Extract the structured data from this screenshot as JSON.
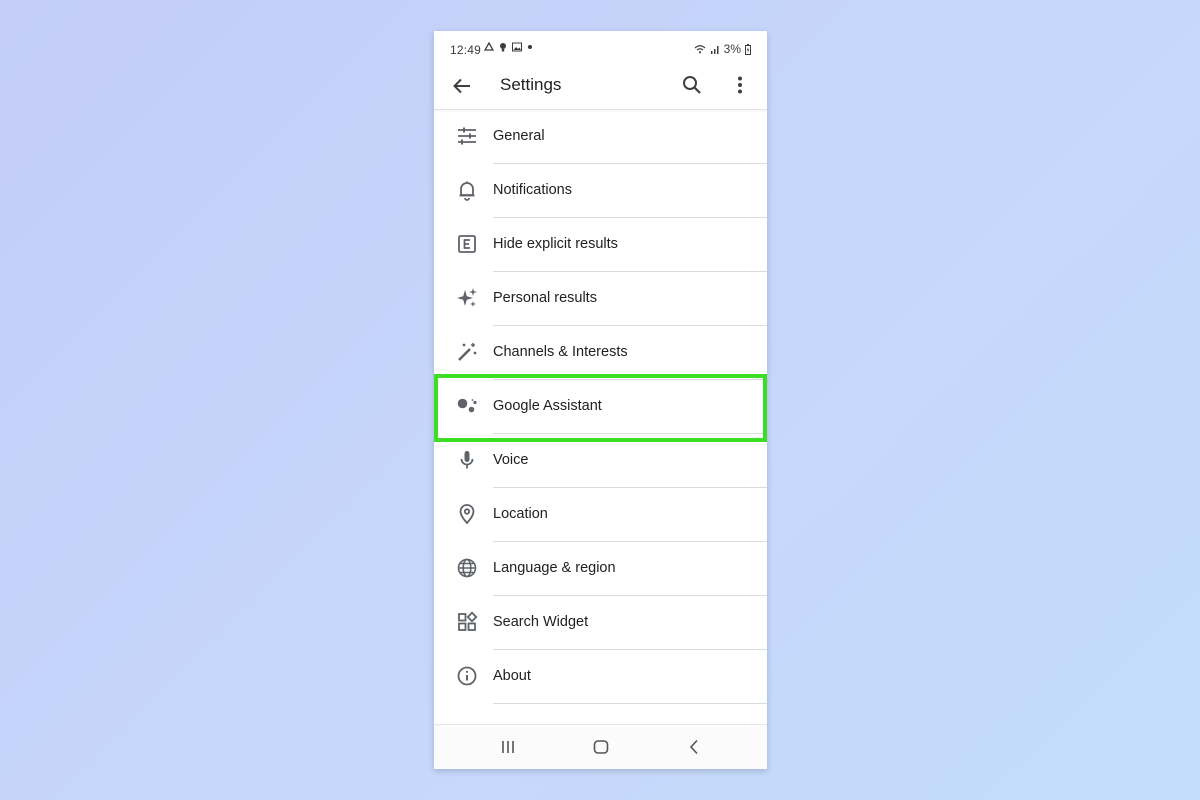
{
  "statusbar": {
    "time": "12:49",
    "left_icons": [
      "drive-icon",
      "bulb-icon",
      "image-icon",
      "dot-icon"
    ],
    "battery": "3%"
  },
  "appbar": {
    "title": "Settings"
  },
  "menu": [
    {
      "label": "General",
      "icon": "tune-icon"
    },
    {
      "label": "Notifications",
      "icon": "bell-icon"
    },
    {
      "label": "Hide explicit results",
      "icon": "explicit-icon"
    },
    {
      "label": "Personal results",
      "icon": "sparkle-icon"
    },
    {
      "label": "Channels & Interests",
      "icon": "magic-wand-icon"
    },
    {
      "label": "Google Assistant",
      "icon": "assistant-icon",
      "highlighted": true
    },
    {
      "label": "Voice",
      "icon": "mic-icon"
    },
    {
      "label": "Location",
      "icon": "location-pin-icon"
    },
    {
      "label": "Language & region",
      "icon": "globe-icon"
    },
    {
      "label": "Search Widget",
      "icon": "widgets-icon"
    },
    {
      "label": "About",
      "icon": "info-icon"
    }
  ],
  "highlight_color": "#3cde25",
  "icon_color": "#5f6368"
}
